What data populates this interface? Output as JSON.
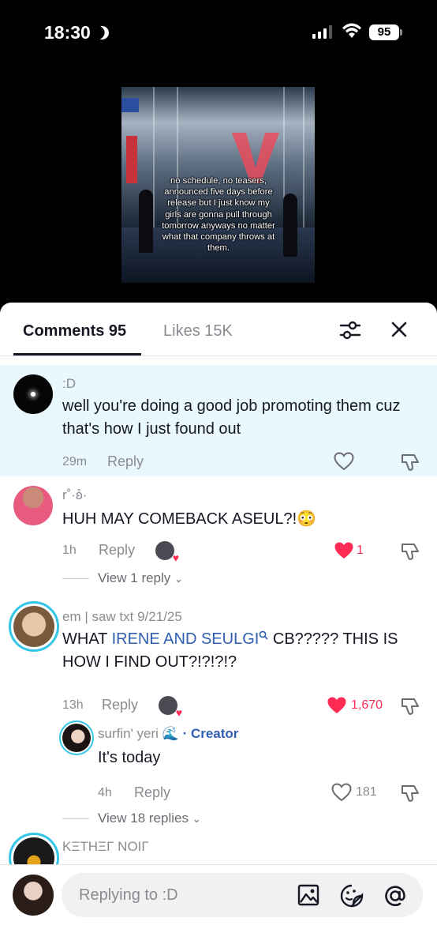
{
  "status_bar": {
    "time": "18:30",
    "battery": "95"
  },
  "video": {
    "caption": "no schedule, no teasers, announced five days before release but I just know my girls are gonna pull through tomorrow anyways no matter what that company throws at them."
  },
  "tabs": {
    "comments": "Comments 95",
    "likes": "Likes 15K"
  },
  "comments": [
    {
      "username": ":D",
      "text": "well you're doing a good job promoting them cuz that's how I just found out",
      "time": "29m",
      "reply_label": "Reply",
      "highlighted": true
    },
    {
      "username": "r˚·ʚ̊·",
      "text": "HUH MAY COMEBACK ASEUL?!😳",
      "time": "1h",
      "reply_label": "Reply",
      "likes": "1",
      "liked": true,
      "view_replies": "View 1 reply"
    },
    {
      "username": "em | saw txt 9/21/25",
      "text_prefix": "WHAT ",
      "text_link": "IRENE AND SEULGI",
      "text_suffix": " CB????? THIS IS",
      "text_line2": "HOW I FIND OUT?!?!?!?",
      "time": "13h",
      "reply_label": "Reply",
      "likes": "1,670",
      "liked": true,
      "reply": {
        "username": "surfin' yeri 🌊",
        "badge": "· Creator",
        "text": "It's today",
        "time": "4h",
        "reply_label": "Reply",
        "likes": "181"
      },
      "view_replies": "View 18 replies"
    },
    {
      "username": "ΚΞΤΗΞΓ ΝΟΙΓ"
    }
  ],
  "input": {
    "placeholder": "Replying to :D"
  },
  "colors": {
    "accent": "#fe2c55",
    "link": "#2f5fb3",
    "highlight_bg": "#e9f8fd",
    "creator": "#2f5fb3"
  }
}
